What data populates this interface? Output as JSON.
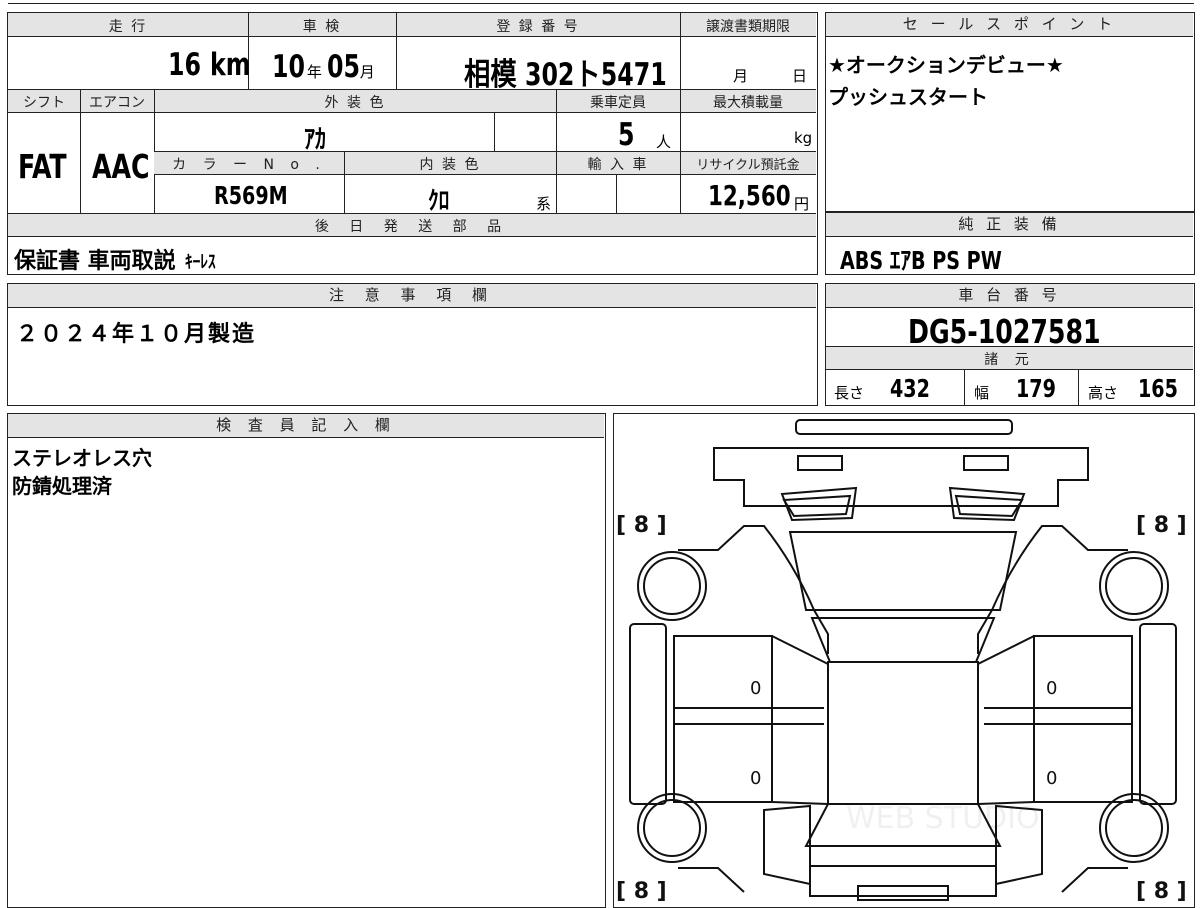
{
  "headers": {
    "mileage": "走 行",
    "inspection": "車 検",
    "registration": "登 録 番 号",
    "transfer_deadline": "譲渡書類期限",
    "sales_point": "セ ー ル ス ポ イ ン ト",
    "shift": "シフト",
    "aircon": "エアコン",
    "exterior_color": "外 装 色",
    "capacity": "乗車定員",
    "max_load": "最大積載量",
    "color_no": "カ ラ ー N o .",
    "interior_color": "内 装 色",
    "import": "輸 入 車",
    "recycle": "リサイクル預託金",
    "later_parts": "後 日 発 送 部 品",
    "genuine_equipment": "純 正 装 備",
    "notes": "注 意 事 項 欄",
    "chassis_no": "車 台 番 号",
    "specs": "諸 元",
    "inspector": "検 査 員 記 入 欄"
  },
  "values": {
    "mileage": "16",
    "mileage_unit": "km",
    "inspection_year": "10",
    "year_unit": "年",
    "inspection_month": "05",
    "month_unit": "月",
    "registration": "相模 302ト5471",
    "deadline_month_unit": "月",
    "deadline_day_unit": "日",
    "sales_point_line1": "★オークションデビュー★",
    "sales_point_line2": "プッシュスタート",
    "shift": "FAT",
    "aircon": "AAC",
    "exterior_color": "ｱｶ",
    "capacity": "5",
    "capacity_unit": "人",
    "load_unit": "kg",
    "color_no": "R569M",
    "interior_color": "ｸﾛ",
    "interior_suffix": "系",
    "recycle": "12,560",
    "recycle_unit": "円",
    "later_parts": "保証書 車両取説",
    "later_parts_small": "ｷｰﾚｽ",
    "genuine_equipment": "ABS ｴｱB PS PW",
    "notes": "２０２４年１０月製造",
    "chassis_no": "DG5-1027581",
    "length_label": "長さ",
    "length": "432",
    "width_label": "幅",
    "width": "179",
    "height_label": "高さ",
    "height": "165",
    "inspector_line1": "ステレオレス穴",
    "inspector_line2": "防錆処理済"
  },
  "diagram": {
    "front_left_tire": "[ 8 ]",
    "front_right_tire": "[ 8 ]",
    "rear_left_tire": "[ 8 ]",
    "rear_right_tire": "[ 8 ]",
    "left_front_door": "0",
    "left_rear_door": "0",
    "right_front_door": "0",
    "right_rear_door": "0",
    "watermark": "WEB STUDIO"
  }
}
